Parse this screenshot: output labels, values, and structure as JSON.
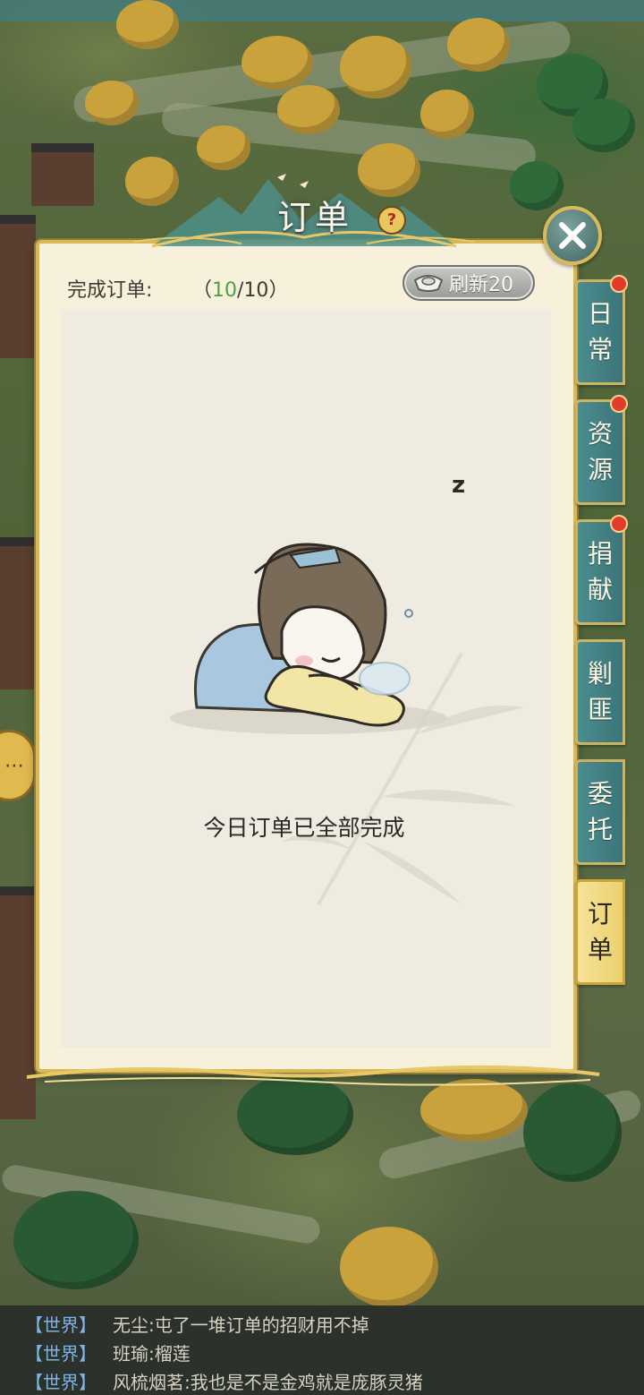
{
  "dialog": {
    "title": "订单",
    "orders_label": "完成订单:",
    "orders_open": "（",
    "orders_done": "10",
    "orders_sep": "/",
    "orders_total": "10",
    "orders_close": "）",
    "refresh_label": "刷新20",
    "empty_message": "今日订单已全部完成",
    "sleep_symbol": "z"
  },
  "tabs": [
    {
      "chars": [
        "日",
        "常"
      ],
      "has_dot": true,
      "active": false
    },
    {
      "chars": [
        "资",
        "源"
      ],
      "has_dot": true,
      "active": false
    },
    {
      "chars": [
        "捐",
        "献"
      ],
      "has_dot": true,
      "active": false
    },
    {
      "chars": [
        "剿",
        "匪"
      ],
      "has_dot": false,
      "active": false
    },
    {
      "chars": [
        "委",
        "托"
      ],
      "has_dot": false,
      "active": false
    },
    {
      "chars": [
        "订",
        "单"
      ],
      "has_dot": false,
      "active": true
    }
  ],
  "chat": [
    {
      "channel": "【世界】",
      "user": "无尘:",
      "message": "屯了一堆订单的招财用不掉"
    },
    {
      "channel": "【世界】",
      "user": "班瑜:",
      "message": "榴莲"
    },
    {
      "channel": "【世界】",
      "user": "风梳烟茗:",
      "message": "我也是不是金鸡就是庞豚灵猪"
    }
  ],
  "icons": [
    "help-icon",
    "close-icon",
    "silver-ingot-icon",
    "chat-bubble-icon"
  ],
  "colors": {
    "tab_teal": "#4a8d90",
    "tab_active": "#f6e398",
    "done_green": "#4aa346",
    "notify_red": "#e23b2b",
    "chat_channel": "#7fb2e6"
  }
}
